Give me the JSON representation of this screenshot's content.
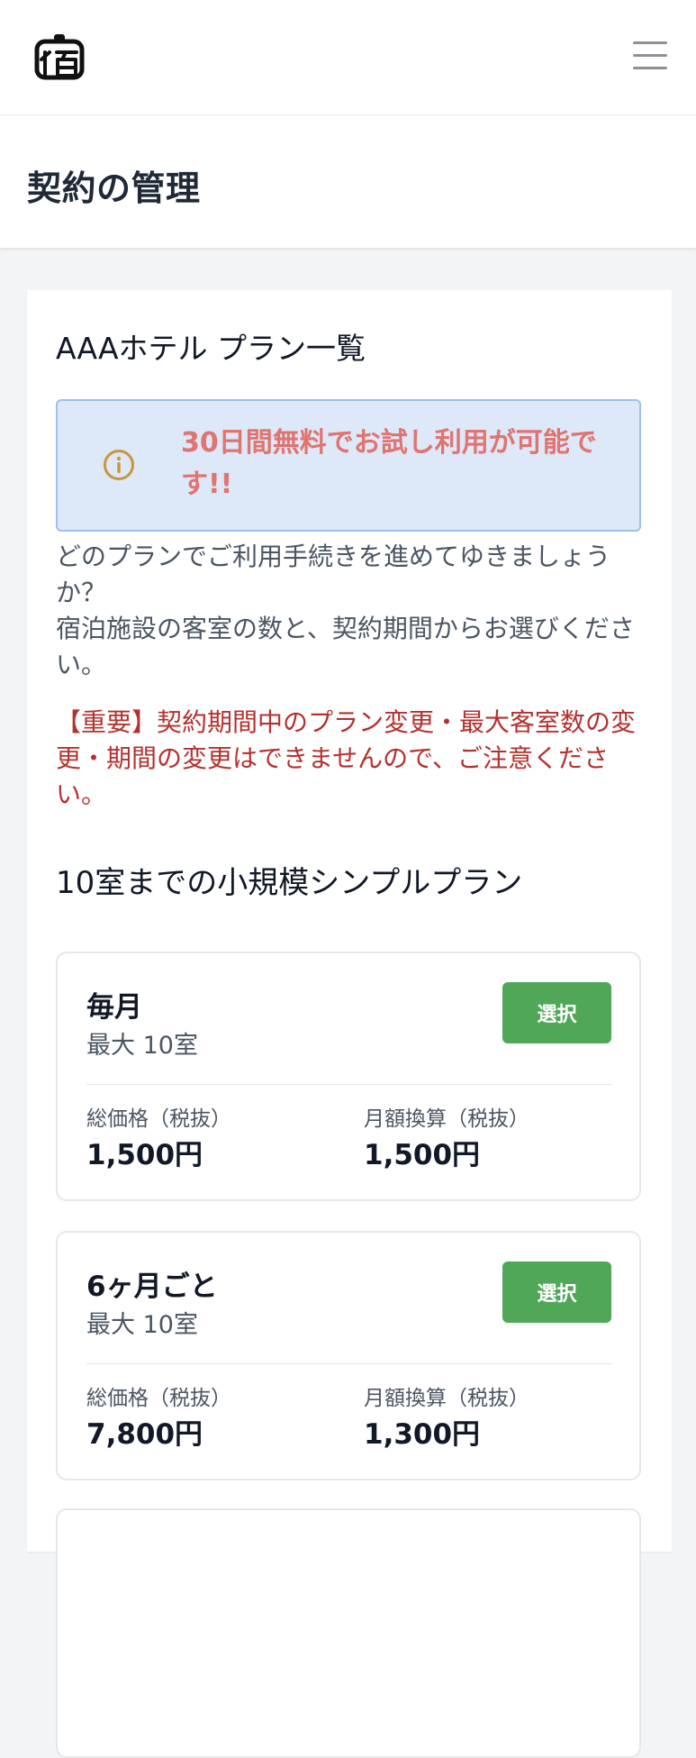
{
  "header": {
    "logo_char": "宿"
  },
  "page": {
    "title": "契約の管理"
  },
  "card": {
    "title": "AAAホテル プラン一覧",
    "notice": "30日間無料でお試し利用が可能です!!",
    "description": "どのプランでご利用手続きを進めてゆきましょうか？\n宿泊施設の客室の数と、契約期間からお選びください。",
    "warning": "【重要】契約期間中のプラン変更・最大客室数の変更・期間の変更はできませんので、ご注意ください。",
    "section_title": "10室までの小規模シンプルプラン",
    "plans": [
      {
        "name": "毎月",
        "max": "最大 10室",
        "select_label": "選択",
        "total_label": "総価格（税抜）",
        "total_value": "1,500円",
        "monthly_label": "月額換算（税抜）",
        "monthly_value": "1,500円"
      },
      {
        "name": "6ヶ月ごと",
        "max": "最大 10室",
        "select_label": "選択",
        "total_label": "総価格（税抜）",
        "total_value": "7,800円",
        "monthly_label": "月額換算（税抜）",
        "monthly_value": "1,300円"
      }
    ]
  },
  "colors": {
    "accent_green": "#4fa757",
    "notice_bg": "#dde8f8",
    "notice_text": "#e07470",
    "warning_text": "#b4312f"
  }
}
